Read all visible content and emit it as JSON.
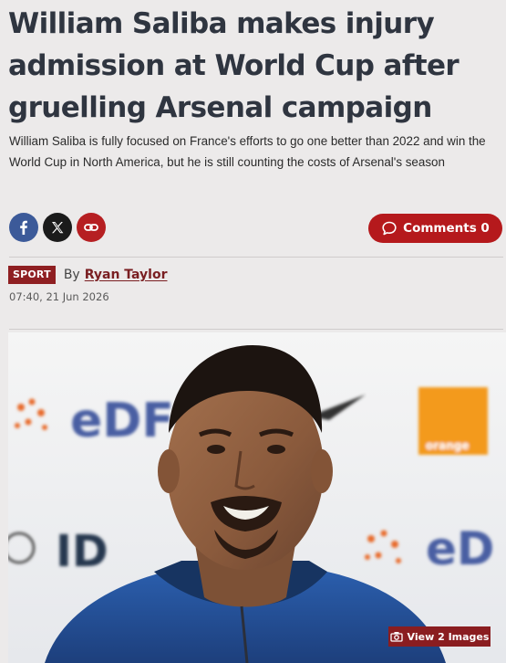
{
  "article": {
    "headline": "William Saliba makes injury admission at World Cup after gruelling Arsenal campaign",
    "standfirst": "William Saliba is fully focused on France's efforts to go one better than 2022 and win the World Cup in North America, but he is still counting the costs of Arsenal's season",
    "section_badge": "SPORT",
    "byline_prefix": "By",
    "author": "Ryan Taylor",
    "timestamp": "07:40, 21 Jun 2026"
  },
  "share": {
    "icons": [
      "facebook-icon",
      "x-icon",
      "link-icon"
    ],
    "comments_label": "Comments 0"
  },
  "photo": {
    "sponsor_text_left": "eDF",
    "sponsor_text_right": "eD",
    "partner_text": "ID",
    "brand_box_text": "orange",
    "gallery_label": "View 2 Images"
  },
  "colors": {
    "brand_red": "#b5191c",
    "badge_red": "#8f1f22",
    "facebook_blue": "#3c5a99",
    "headline": "#2f3540",
    "background": "#eceaea"
  }
}
